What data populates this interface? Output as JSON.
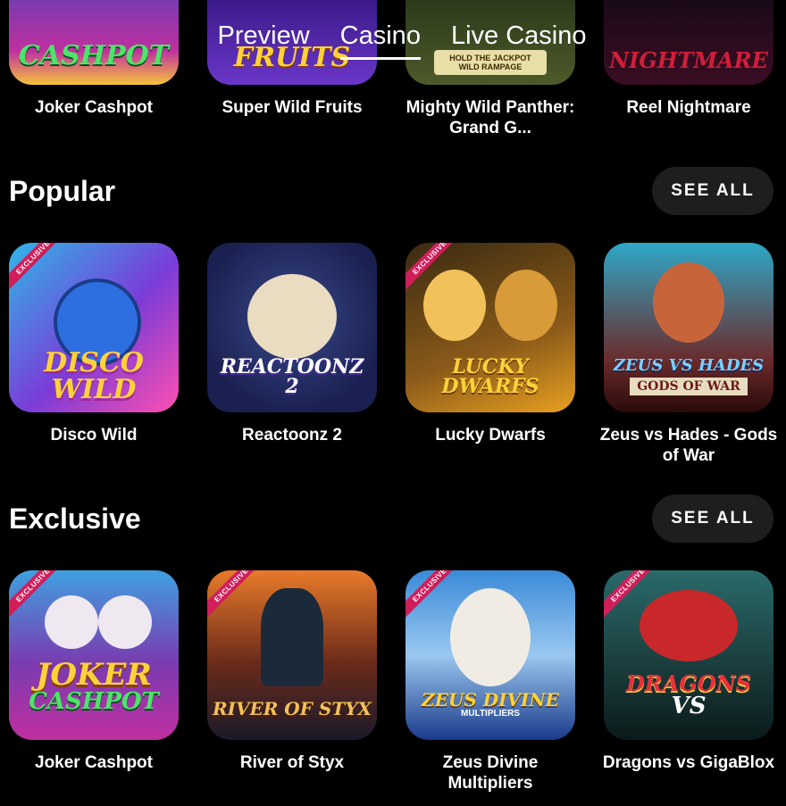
{
  "tabs": [
    {
      "label": "Preview",
      "active": false
    },
    {
      "label": "Casino",
      "active": true
    },
    {
      "label": "Live Casino",
      "active": false
    }
  ],
  "top_row": [
    {
      "title": "Joker Cashpot",
      "art": "CASHPOT"
    },
    {
      "title": "Super Wild Fruits",
      "art": "FRUITS"
    },
    {
      "title": "Mighty Wild Panther: Grand G...",
      "art": "HOLD THE JACKPOT WILD RAMPAGE"
    },
    {
      "title": "Reel Nightmare",
      "art": "NIGHTMARE"
    }
  ],
  "popular": {
    "title": "Popular",
    "see_all": "SEE ALL",
    "games": [
      {
        "title": "Disco Wild",
        "art": "DISCO WILD",
        "badge": "EXCLUSIVE"
      },
      {
        "title": "Reactoonz 2",
        "art": "REACTOONZ 2",
        "badge": ""
      },
      {
        "title": "Lucky Dwarfs",
        "art": "LUCKY DWARFS",
        "badge": "EXCLUSIVE"
      },
      {
        "title": "Zeus vs Hades - Gods of War",
        "art": "ZEUS VS HADES",
        "art2": "GODS OF WAR",
        "badge": ""
      }
    ]
  },
  "exclusive": {
    "title": "Exclusive",
    "see_all": "SEE ALL",
    "games": [
      {
        "title": "Joker Cashpot",
        "art": "JOKER",
        "art2": "CASHPOT",
        "badge": "EXCLUSIVE"
      },
      {
        "title": "River of Styx",
        "art": "RIVER OF STYX",
        "badge": "EXCLUSIVE"
      },
      {
        "title": "Zeus Divine Multipliers",
        "art": "ZEUS DIVINE",
        "art2": "MULTIPLIERS",
        "badge": "EXCLUSIVE"
      },
      {
        "title": "Dragons vs GigaBlox",
        "art": "DRAGONS",
        "art2": "VS",
        "badge": "EXCLUSIVE"
      }
    ]
  },
  "colors": {
    "background": "#000000",
    "see_all_bg": "#1e1e1e",
    "badge": "#d11e5b"
  }
}
